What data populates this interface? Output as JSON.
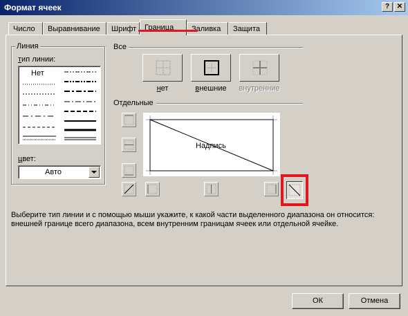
{
  "window": {
    "title": "Формат ячеек",
    "help_glyph": "?",
    "close_glyph": "✕"
  },
  "tabs": [
    "Число",
    "Выравнивание",
    "Шрифт",
    "Граница",
    "Заливка",
    "Защита"
  ],
  "line": {
    "group_label": "Линия",
    "type_label": "тип линии:",
    "none_label": "Нет",
    "color_label": "цвет:",
    "color_value": "Авто"
  },
  "presets": {
    "group_label": "Все",
    "none": "нет",
    "outline": "внешние",
    "inside": "внутренние"
  },
  "border": {
    "group_label": "Отдельные",
    "preview_text": "Надпись"
  },
  "hint": {
    "line1": "Выберите тип линии и с помощью мыши укажите, к какой части выделенного диапазона он относится:",
    "line2": "внешней границе всего диапазона, всем внутренним границам ячеек или отдельной ячейке."
  },
  "buttons": {
    "ok": "ОК",
    "cancel": "Отмена"
  },
  "annotation_color": "#e0181e"
}
